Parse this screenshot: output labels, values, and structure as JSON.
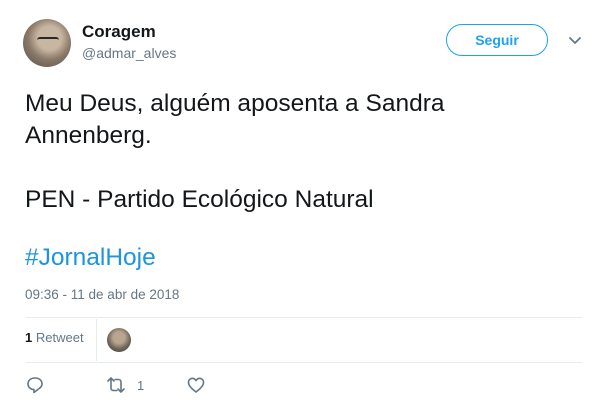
{
  "user": {
    "name": "Coragem",
    "handle": "@admar_alves"
  },
  "follow_button": "Seguir",
  "tweet": {
    "text": "Meu Deus, alguém aposenta a Sandra\nAnnenberg.\n\nPEN - Partido Ecológico Natural",
    "hashtag": "#JornalHoje",
    "timestamp": "09:36 - 11 de abr de 2018"
  },
  "stats": {
    "retweet_count": "1",
    "retweet_label": "Retweet"
  },
  "actions": {
    "reply_icon": "reply-icon",
    "retweet_icon": "retweet-icon",
    "retweet_count": "1",
    "like_icon": "heart-icon"
  },
  "colors": {
    "accent": "#1da1f2",
    "hashtag": "#1b95e0",
    "muted": "#657786"
  }
}
